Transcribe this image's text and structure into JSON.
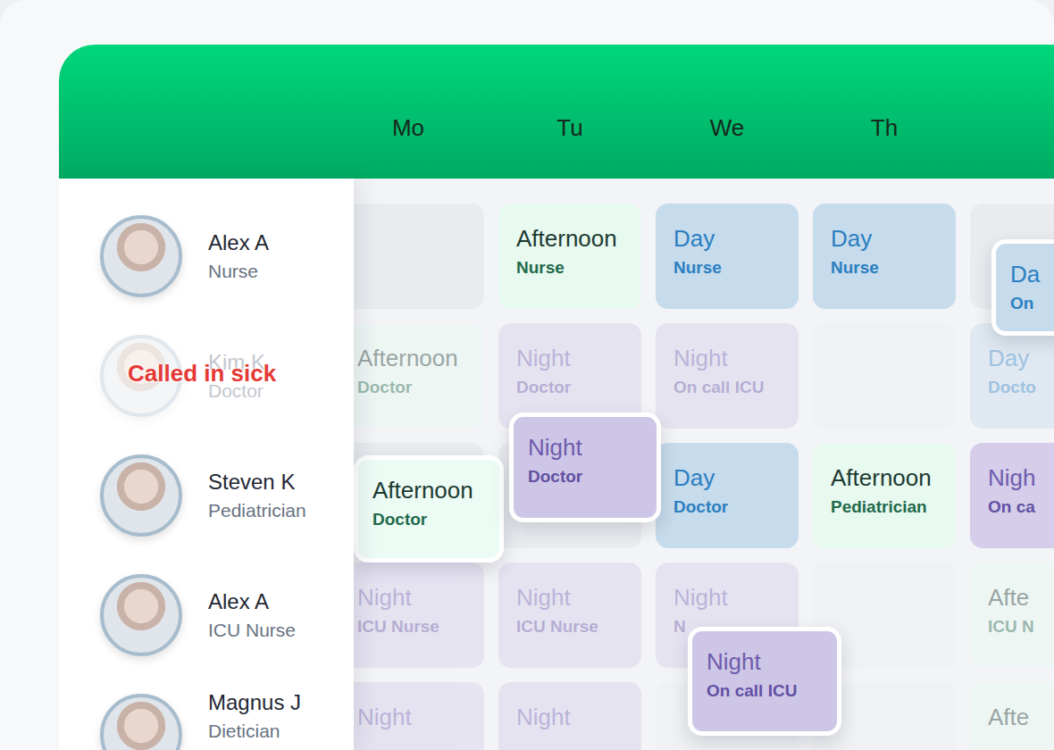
{
  "header": {
    "days": [
      "Mo",
      "Tu",
      "We",
      "Th"
    ]
  },
  "staff": [
    {
      "name": "Alex A",
      "role": "Nurse",
      "dimmed": false,
      "shifts_dimmed": false,
      "shifts": [
        {
          "kind": "empty",
          "color": "#e9ebef"
        },
        {
          "kind": "afternoon",
          "color": "#e8f9f0",
          "title": "Afternoon",
          "subtitle": "Nurse"
        },
        {
          "kind": "day",
          "color": "#c6dbeb",
          "title": "Day",
          "subtitle": "Nurse"
        },
        {
          "kind": "day",
          "color": "#c6dbeb",
          "title": "Day",
          "subtitle": "Nurse"
        },
        {
          "kind": "empty",
          "color": "#e9ebef",
          "overlay": {
            "kind": "day",
            "color": "#c6dbeb",
            "title": "Da",
            "subtitle": "On"
          }
        }
      ]
    },
    {
      "name": "Kim K",
      "role": "Doctor",
      "dimmed": true,
      "status": "Called in sick",
      "shifts_dimmed": true,
      "shifts": [
        {
          "kind": "afternoon",
          "color": "#e8f9f0",
          "title": "Afternoon",
          "subtitle": "Doctor"
        },
        {
          "kind": "night",
          "color": "#d5cdea",
          "title": "Night",
          "subtitle": "Doctor"
        },
        {
          "kind": "night",
          "color": "#d5cdea",
          "title": "Night",
          "subtitle": "On call ICU"
        },
        {
          "kind": "empty",
          "color": "#e9ebef"
        },
        {
          "kind": "day",
          "color": "#c6dbeb",
          "title": "Day",
          "subtitle": "Docto"
        }
      ]
    },
    {
      "name": "Steven K",
      "role": "Pediatrician",
      "dimmed": false,
      "shifts_dimmed": false,
      "shifts": [
        {
          "kind": "empty",
          "color": "#e9ebef",
          "overlay": {
            "kind": "afternoon",
            "color": "#ecfbf4",
            "title": "Afternoon",
            "subtitle": "Doctor"
          }
        },
        {
          "kind": "empty",
          "color": "#e9ebef",
          "overlay": {
            "kind": "night",
            "color": "#cec6e6",
            "title": "Night",
            "subtitle": "Doctor"
          }
        },
        {
          "kind": "day",
          "color": "#c6dbeb",
          "title": "Day",
          "subtitle": "Doctor"
        },
        {
          "kind": "afternoon",
          "color": "#e8f9f0",
          "title": "Afternoon",
          "subtitle": "Pediatrician"
        },
        {
          "kind": "night",
          "color": "#d5cdea",
          "title": "Nigh",
          "subtitle": "On ca"
        }
      ]
    },
    {
      "name": "Alex A",
      "role": "ICU Nurse",
      "dimmed": false,
      "shifts_dimmed": true,
      "shifts": [
        {
          "kind": "night",
          "color": "#d5cdea",
          "title": "Night",
          "subtitle": "ICU Nurse"
        },
        {
          "kind": "night",
          "color": "#d5cdea",
          "title": "Night",
          "subtitle": "ICU Nurse"
        },
        {
          "kind": "night",
          "color": "#d5cdea",
          "title": "Night",
          "subtitle": "N",
          "overlay": {
            "kind": "night",
            "color": "#cec6e6",
            "title": "Night",
            "subtitle": "On call ICU"
          }
        },
        {
          "kind": "empty",
          "color": "#e9ebef"
        },
        {
          "kind": "afternoon",
          "color": "#e8f9f0",
          "title": "Afte",
          "subtitle": "ICU N"
        }
      ]
    },
    {
      "name": "Magnus J",
      "role": "Dietician",
      "dimmed": false,
      "shifts_dimmed": true,
      "shifts": [
        {
          "kind": "night",
          "color": "#d5cdea",
          "title": "Night"
        },
        {
          "kind": "night",
          "color": "#d5cdea",
          "title": "Night"
        },
        {
          "kind": "empty",
          "color": "#e9ebef"
        },
        {
          "kind": "empty",
          "color": "#e9ebef"
        },
        {
          "kind": "afternoon",
          "color": "#e8f9f0",
          "title": "Afte"
        }
      ]
    }
  ]
}
